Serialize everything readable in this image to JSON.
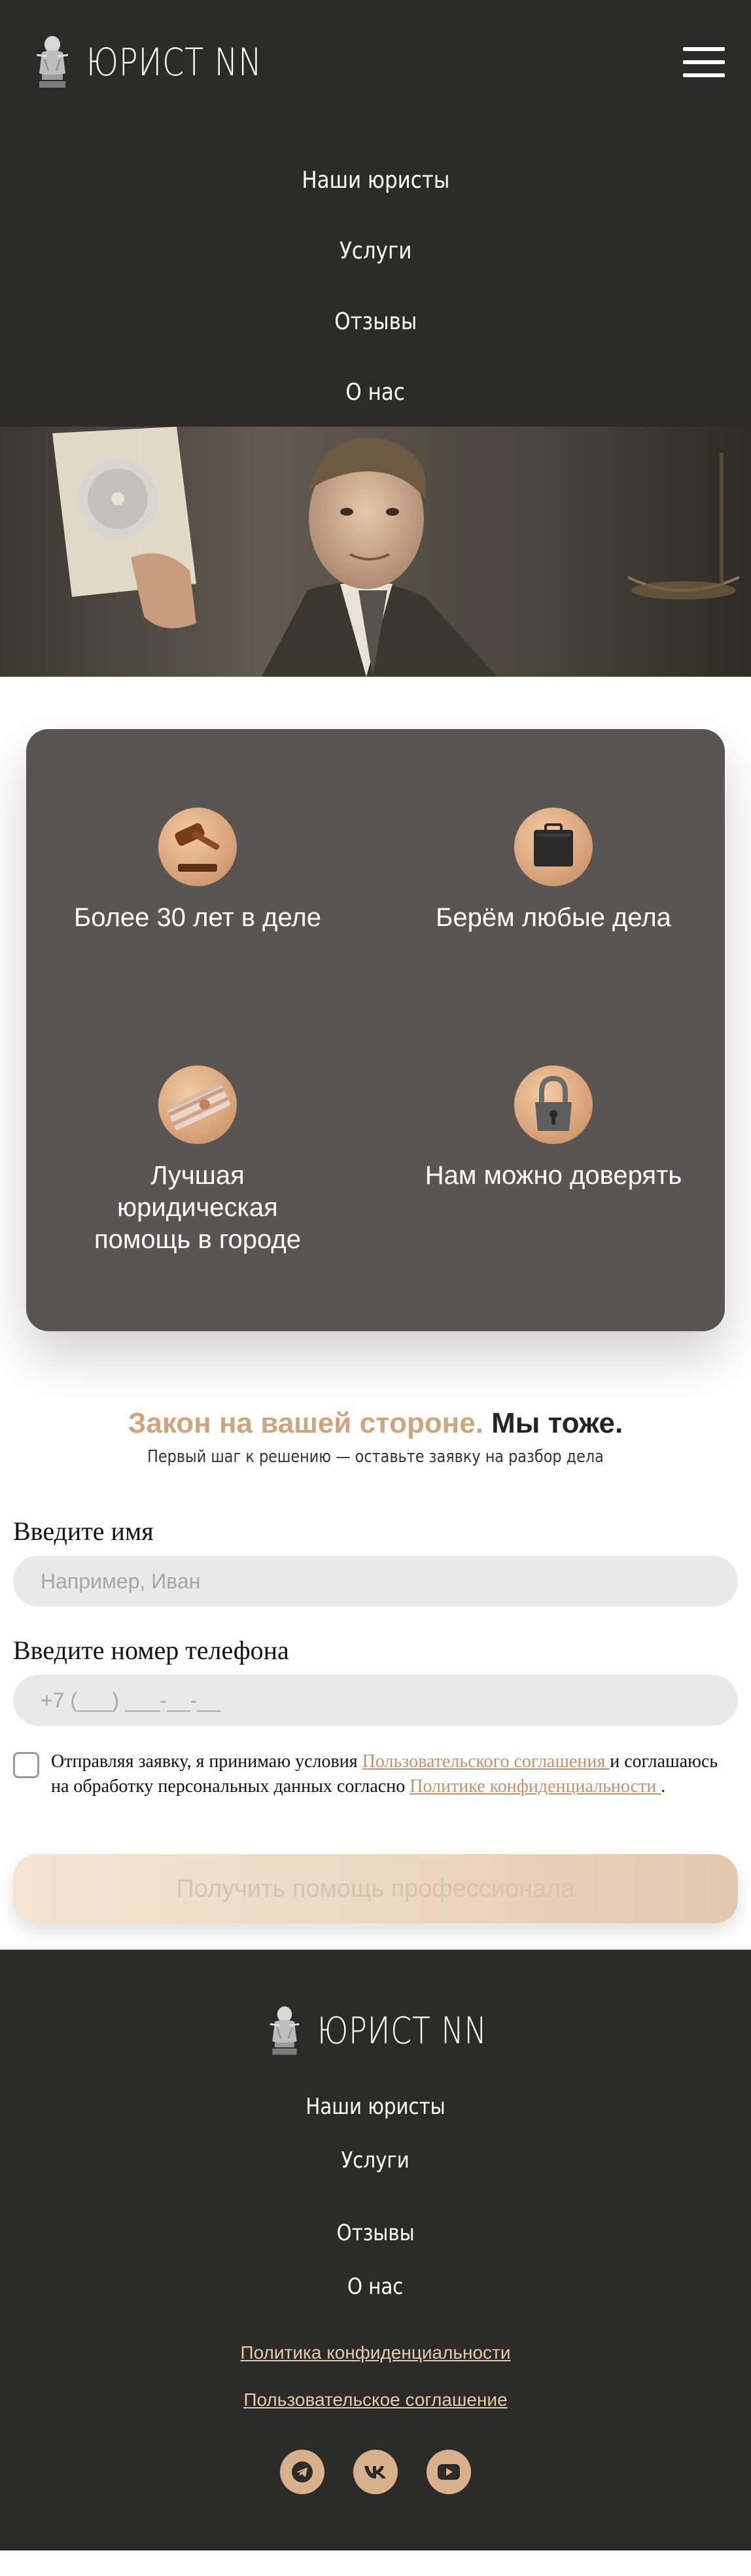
{
  "header": {
    "brand": "ЮРИСТ NN",
    "menu_icon": "hamburger-menu-icon",
    "nav": [
      "Наши юристы",
      "Услуги",
      "Отзывы",
      "О нас"
    ]
  },
  "features": [
    {
      "text": "Более 30 лет в деле",
      "icon": "gavel-icon"
    },
    {
      "text": "Берём любые дела",
      "icon": "briefcase-icon"
    },
    {
      "text": "Лучшая юридическая помощь в городе",
      "icon": "money-stack-icon"
    },
    {
      "text": "Нам можно доверять",
      "icon": "padlock-icon"
    }
  ],
  "cta": {
    "title_accent": "Закон на вашей стороне.",
    "title_dark": "Мы тоже.",
    "subtitle": "Первый шаг к решению — оставьте заявку на разбор дела"
  },
  "form": {
    "name_label": "Введите имя",
    "name_placeholder": "Например, Иван",
    "phone_label": "Введите номер телефона",
    "phone_placeholder": "+7 (___) ___-__-__",
    "consent_before": "Отправляя заявку, я принимаю условия ",
    "consent_link1": "Пользовательского соглашения ",
    "consent_middle": "и соглашаюсь на обработку персональных данных согласно ",
    "consent_link2": "Политике конфиденциальности ",
    "consent_end": ".",
    "submit_label": "Получить помощь профессионала"
  },
  "footer": {
    "brand": "ЮРИСТ NN",
    "nav": [
      "Наши юристы",
      "Услуги",
      "Отзывы",
      "О нас"
    ],
    "privacy": "Политика конфиденциальности",
    "agreement": "Пользовательское соглашение",
    "socials": [
      "telegram-icon",
      "vk-icon",
      "youtube-icon"
    ]
  },
  "colors": {
    "dark_bg": "#2b2b2a",
    "card_bg": "#585552",
    "accent": "#cfa57f",
    "link": "#c8906a",
    "footer_link": "#e9c9a5"
  }
}
